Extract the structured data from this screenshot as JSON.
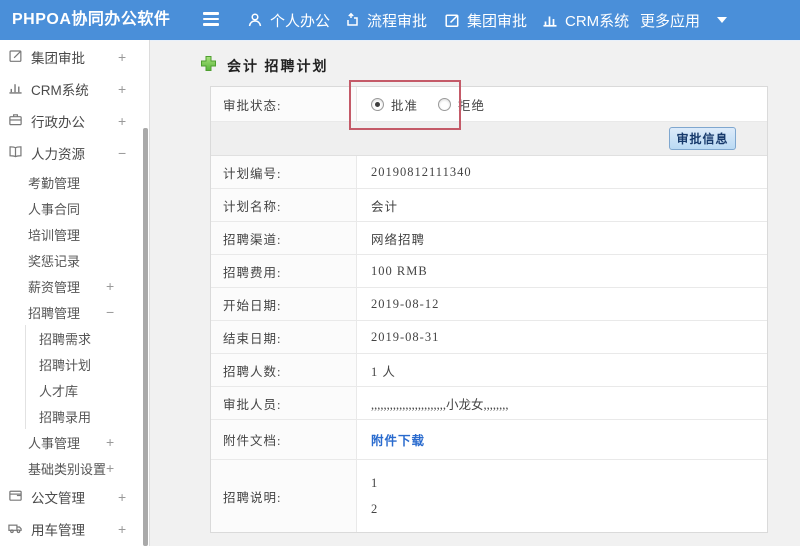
{
  "navbar": {
    "logo": "PHPOA协同办公软件",
    "items": [
      {
        "label": "个人办公",
        "icon": "user-icon"
      },
      {
        "label": "流程审批",
        "icon": "process-icon"
      },
      {
        "label": "集团审批",
        "icon": "edit-square-icon"
      },
      {
        "label": "CRM系统",
        "icon": "bar-chart-icon"
      },
      {
        "label": "更多应用",
        "icon": "caret-down-icon"
      }
    ]
  },
  "sidebar": {
    "items": [
      {
        "label": "集团审批",
        "level": 1,
        "icon": "edit-square-icon",
        "toggle": "+"
      },
      {
        "label": "CRM系统",
        "level": 1,
        "icon": "bar-chart-icon",
        "toggle": "+"
      },
      {
        "label": "行政办公",
        "level": 1,
        "icon": "briefcase-icon",
        "toggle": "+"
      },
      {
        "label": "人力资源",
        "level": 1,
        "icon": "book-icon",
        "toggle": "−"
      },
      {
        "label": "考勤管理",
        "level": 2
      },
      {
        "label": "人事合同",
        "level": 2
      },
      {
        "label": "培训管理",
        "level": 2
      },
      {
        "label": "奖惩记录",
        "level": 2
      },
      {
        "label": "薪资管理",
        "level": 2,
        "toggle": "+"
      },
      {
        "label": "招聘管理",
        "level": 2,
        "toggle": "−"
      },
      {
        "label": "招聘需求",
        "level": 3
      },
      {
        "label": "招聘计划",
        "level": 3
      },
      {
        "label": "人才库",
        "level": 3
      },
      {
        "label": "招聘录用",
        "level": 3
      },
      {
        "label": "人事管理",
        "level": 2,
        "toggle": "+"
      },
      {
        "label": "基础类别设置",
        "level": 2,
        "toggle": "+"
      },
      {
        "label": "公文管理",
        "level": 1,
        "icon": "document-icon",
        "toggle": "+"
      },
      {
        "label": "用车管理",
        "level": 1,
        "icon": "car-icon",
        "toggle": "+"
      }
    ]
  },
  "main": {
    "title": "会计 招聘计划",
    "approval_row": {
      "label": "审批状态:",
      "options": [
        {
          "label": "批准",
          "selected": true
        },
        {
          "label": "拒绝",
          "selected": false
        }
      ]
    },
    "toolbar": {
      "approve_button_label": "审批信息"
    },
    "rows": [
      {
        "label": "计划编号:",
        "value": "20190812111340"
      },
      {
        "label": "计划名称:",
        "value": "会计"
      },
      {
        "label": "招聘渠道:",
        "value": "网络招聘"
      },
      {
        "label": "招聘费用:",
        "value": "100 RMB"
      },
      {
        "label": "开始日期:",
        "value": "2019-08-12"
      },
      {
        "label": "结束日期:",
        "value": "2019-08-31"
      },
      {
        "label": "招聘人数:",
        "value": "1 人"
      },
      {
        "label": "审批人员:",
        "value": ",,,,,,,,,,,,,,,,,,,,,,,,小龙女,,,,,,,,"
      },
      {
        "label": "附件文档:",
        "value": "附件下载"
      },
      {
        "label": "招聘说明:",
        "line1": "1",
        "line2": "2"
      }
    ]
  },
  "colors": {
    "navbar_blue": "#4a8fd9",
    "link_blue": "#2a6bce",
    "highlight_red": "#c45a68",
    "plus_green": "#6cc24a"
  }
}
